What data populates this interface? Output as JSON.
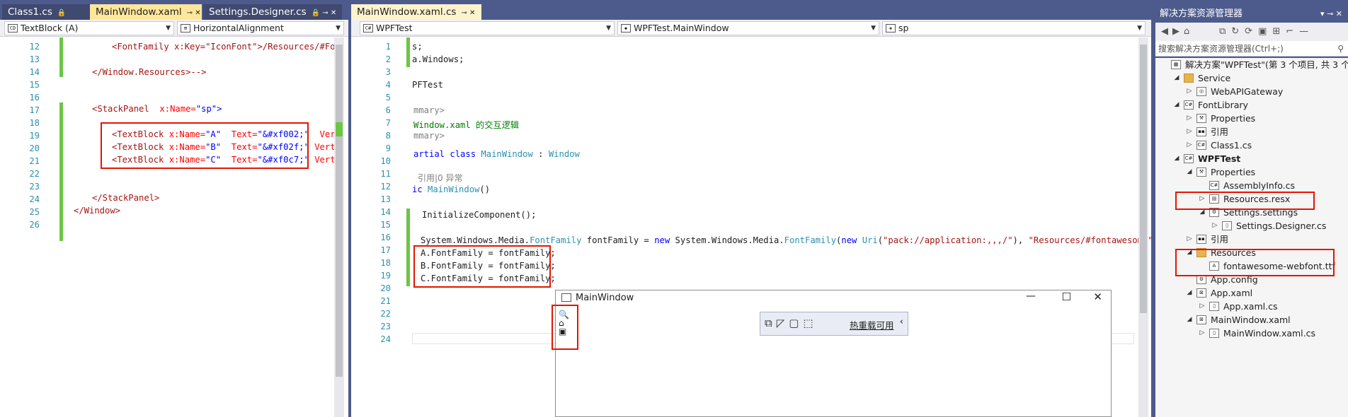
{
  "left_editor": {
    "tabs": [
      {
        "label": "Class1.cs",
        "glyph": "🔒"
      },
      {
        "label": "MainWindow.xaml",
        "glyph": "⊸  ✕"
      },
      {
        "label": "Settings.Designer.cs",
        "glyph": "🔒 ⊸ ✕"
      }
    ],
    "nav_left": "TextBlock (A)",
    "nav_right": "HorizontalAlignment",
    "line_numbers": [
      "12",
      "13",
      "14",
      "15",
      "16",
      "17",
      "18",
      "19",
      "20",
      "21",
      "22",
      "23",
      "24",
      "25",
      "26"
    ],
    "lines": {
      "l12_a": "<FontFamily x:Key=\"IconFont\">",
      "l12_b": "/Resources/#Fon",
      "l14": "</Window.Resources>-->",
      "l17_tag": "<StackPanel",
      "l17_attr": "x:Name=",
      "l17_val": "\"sp\">",
      "l19_tag": "<TextBlock",
      "l19_a1": "x:Name=",
      "l19_v1": "\"A\"",
      "l19_a2": "Text=",
      "l19_v2": "\"&#xf002;\"",
      "l19_tail": "Vert",
      "l20_v1": "\"B\"",
      "l20_v2": "\"&#xf02f;\"",
      "l20_tail": "Verti",
      "l21_v1": "\"C\"",
      "l21_v2": "\"&#xf0c7;\"",
      "l21_tail": "Verti",
      "l24": "</StackPanel>",
      "l25": "</Window>"
    }
  },
  "right_editor": {
    "tab": {
      "label": "MainWindow.xaml.cs",
      "glyph": "⊸  ✕"
    },
    "nav1": "WPFTest",
    "nav2": "WPFTest.MainWindow",
    "nav3": "sp",
    "line_numbers": [
      "1",
      "2",
      "3",
      "4",
      "5",
      "6",
      "7",
      "8",
      "9",
      "10",
      "11",
      "12",
      "13",
      "14",
      "15",
      "16",
      "17",
      "18",
      "19",
      "20",
      "21",
      "22",
      "23",
      "24"
    ],
    "lines": {
      "l1": "s;",
      "l2": "a.Windows;",
      "l4": "PFTest",
      "l6": "mmary>",
      "l7": "Window.xaml 的交互逻辑",
      "l8": "mmary>",
      "l9_a": "artial",
      "l9_b": "class",
      "l9_c": "MainWindow",
      "l9_d": ":",
      "l9_e": "Window",
      "l10_ref": "引用|0 异常",
      "l11_a": "ic",
      "l11_b": "MainWindow",
      "l11_c": "()",
      "l13": "InitializeComponent();",
      "l15_a": "System.Windows.Media.",
      "l15_b": "FontFamily",
      "l15_c": " fontFamily = ",
      "l15_d": "new",
      "l15_e": " System.Windows.Media.",
      "l15_f": "FontFamily",
      "l15_g": "(",
      "l15_h": "new",
      "l15_i": "Uri",
      "l15_j": "(",
      "l15_k": "\"pack://application:,,,/\"",
      "l15_l": "), ",
      "l15_m": "\"Resources/#fontawesome\"",
      "l15_n": ")",
      "l16": "A.FontFamily = fontFamily;",
      "l17": "B.FontFamily = fontFamily;",
      "l18": "C.FontFamily = fontFamily;"
    }
  },
  "main_window": {
    "title": "MainWindow",
    "min": "—",
    "max": "☐",
    "close": "✕",
    "hot_reload": "热重载可用",
    "icons": [
      "search-icon",
      "tag-icon",
      "save-icon"
    ]
  },
  "solution": {
    "title": "解决方案资源管理器",
    "title_glyphs": "▾ ⊸ ✕",
    "search_placeholder": "搜索解决方案资源管理器(Ctrl+;)",
    "items": [
      {
        "label": "解决方案\"WPFTest\"(第 3 个项目, 共 3 个)",
        "indent": 0,
        "arrow": "",
        "icon": "sln"
      },
      {
        "label": "Service",
        "indent": 1,
        "arrow": "◢",
        "icon": "folder"
      },
      {
        "label": "WebAPIGateway",
        "indent": 2,
        "arrow": "▷",
        "icon": "web"
      },
      {
        "label": "FontLibrary",
        "indent": 1,
        "arrow": "◢",
        "icon": "cs"
      },
      {
        "label": "Properties",
        "indent": 2,
        "arrow": "▷",
        "icon": "wrench"
      },
      {
        "label": "引用",
        "indent": 2,
        "arrow": "▷",
        "icon": "ref"
      },
      {
        "label": "Class1.cs",
        "indent": 2,
        "arrow": "▷",
        "icon": "csfile"
      },
      {
        "label": "WPFTest",
        "indent": 1,
        "arrow": "◢",
        "icon": "cs",
        "bold": true
      },
      {
        "label": "Properties",
        "indent": 2,
        "arrow": "◢",
        "icon": "wrench"
      },
      {
        "label": "AssemblyInfo.cs",
        "indent": 3,
        "arrow": "",
        "icon": "csfile"
      },
      {
        "label": "Resources.resx",
        "indent": 3,
        "arrow": "▷",
        "icon": "resx"
      },
      {
        "label": "Settings.settings",
        "indent": 3,
        "arrow": "◢",
        "icon": "gear"
      },
      {
        "label": "Settings.Designer.cs",
        "indent": 4,
        "arrow": "▷",
        "icon": "file"
      },
      {
        "label": "引用",
        "indent": 2,
        "arrow": "▷",
        "icon": "ref"
      },
      {
        "label": "Resources",
        "indent": 2,
        "arrow": "◢",
        "icon": "folder"
      },
      {
        "label": "fontawesome-webfont.ttf",
        "indent": 3,
        "arrow": "",
        "icon": "ttf"
      },
      {
        "label": "App.config",
        "indent": 2,
        "arrow": "",
        "icon": "config"
      },
      {
        "label": "App.xaml",
        "indent": 2,
        "arrow": "◢",
        "icon": "xaml"
      },
      {
        "label": "App.xaml.cs",
        "indent": 3,
        "arrow": "▷",
        "icon": "file"
      },
      {
        "label": "MainWindow.xaml",
        "indent": 2,
        "arrow": "◢",
        "icon": "xaml"
      },
      {
        "label": "MainWindow.xaml.cs",
        "indent": 3,
        "arrow": "▷",
        "icon": "file"
      }
    ]
  },
  "colors": {
    "accent": "#4d5b8c",
    "selected_tab": "#ffe79a",
    "highlight_box": "#e51400",
    "changed_bar": "#6cc644"
  }
}
